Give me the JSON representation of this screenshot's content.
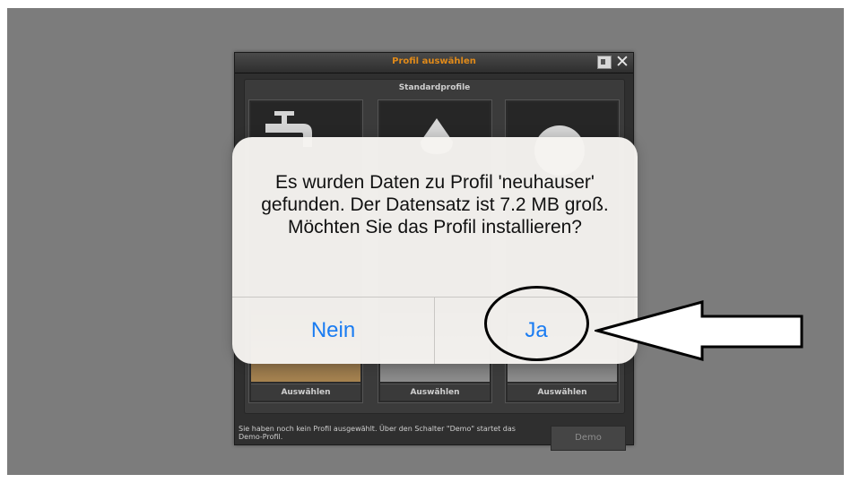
{
  "window": {
    "title": "Profil auswählen",
    "help_icon": "help-icon",
    "close_glyph": "✕"
  },
  "standard_profiles": {
    "title": "Standardprofile",
    "cards": [
      {
        "icon": "faucet-icon",
        "select_label": "Auswählen"
      },
      {
        "icon": "drop-icon",
        "select_label": "Auswählen"
      },
      {
        "icon": "circle-icon",
        "select_label": "Auswählen"
      }
    ]
  },
  "footer": {
    "message": "Sie haben noch kein Profil ausgewählt. Über den Schalter \"Demo\" startet das Demo-Profil.",
    "demo_label": "Demo"
  },
  "alert": {
    "message": "Es wurden Daten zu Profil 'neuhauser' gefunden. Der Datensatz ist 7.2 MB groß. Möchten Sie das Profil installieren?",
    "no_label": "Nein",
    "yes_label": "Ja"
  },
  "colors": {
    "accent_title": "#e08a1a",
    "ios_blue": "#1a7cf2",
    "backdrop": "#7c7c7c"
  }
}
